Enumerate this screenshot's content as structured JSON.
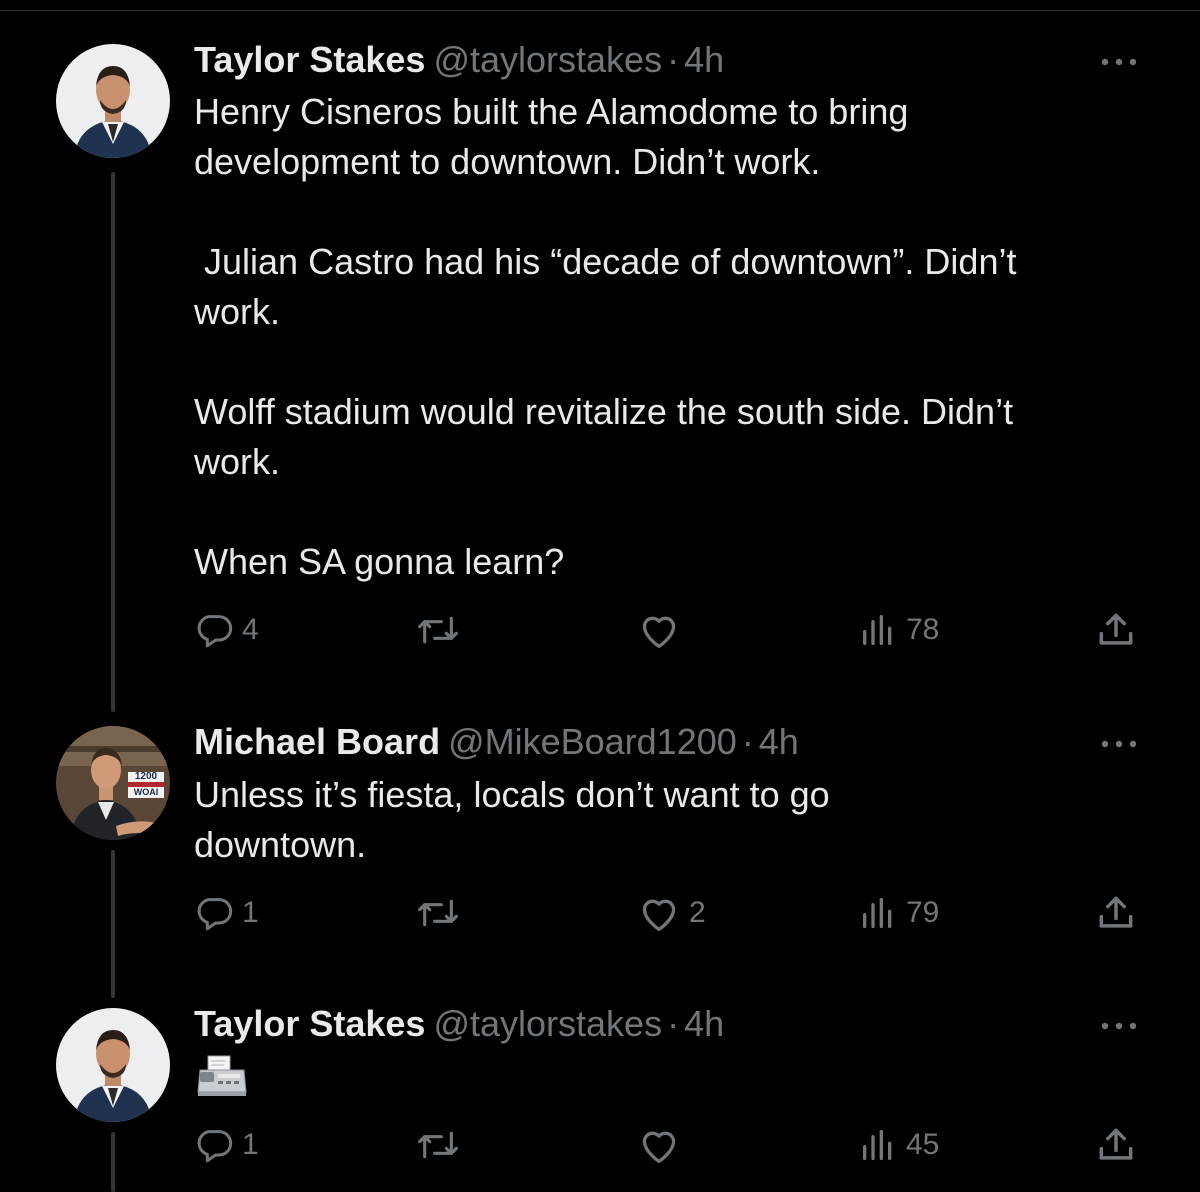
{
  "tweets": [
    {
      "name": "Taylor Stakes",
      "handle": "@taylorstakes",
      "separator": "·",
      "time": "4h",
      "text": "Henry Cisneros built the Alamodome to bring\ndevelopment to downtown. Didn’t work.\n\n Julian Castro had his “decade of downtown”. Didn’t\nwork.\n\nWolff stadium would revitalize the south side. Didn’t\nwork.\n\nWhen SA gonna learn?",
      "replies": "4",
      "retweets": "",
      "likes": "",
      "views": "78"
    },
    {
      "name": "Michael Board",
      "handle": "@MikeBoard1200",
      "separator": "·",
      "time": "4h",
      "text": "Unless it’s fiesta, locals don’t want to go\ndowntown.",
      "avatar_badge_line1": "1200",
      "avatar_badge_line2": "WOAI",
      "replies": "1",
      "retweets": "",
      "likes": "2",
      "views": "79"
    },
    {
      "name": "Taylor Stakes",
      "handle": "@taylorstakes",
      "separator": "·",
      "time": "4h",
      "text": "",
      "emoji": "fax-machine-emoji",
      "replies": "1",
      "retweets": "",
      "likes": "",
      "views": "45"
    }
  ],
  "icons": {
    "reply": "reply-icon",
    "retweet": "retweet-icon",
    "like": "like-icon",
    "views": "views-icon",
    "share": "share-icon",
    "more": "more-icon"
  },
  "colors": {
    "background": "#000000",
    "text": "#e7e9ea",
    "muted": "#71767b",
    "thread_line": "#333639"
  }
}
